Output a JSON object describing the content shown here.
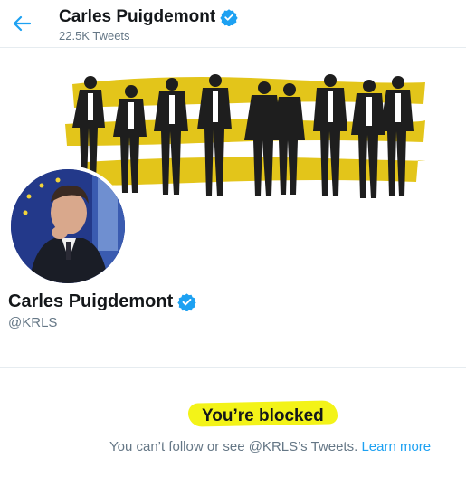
{
  "header": {
    "name": "Carles Puigdemont",
    "tweet_count": "22.5K Tweets"
  },
  "profile": {
    "name": "Carles Puigdemont",
    "handle": "@KRLS"
  },
  "blocked": {
    "title": "You’re blocked",
    "message": "You can’t follow or see @KRLS’s Tweets.",
    "link": "Learn more"
  },
  "colors": {
    "accent": "#1da1f2",
    "verified": "#1da1f2",
    "highlight": "#f3f318",
    "banner_brush": "#e3c51a"
  },
  "icons": {
    "back": "arrow-left-icon",
    "verified": "verified-badge-icon"
  }
}
